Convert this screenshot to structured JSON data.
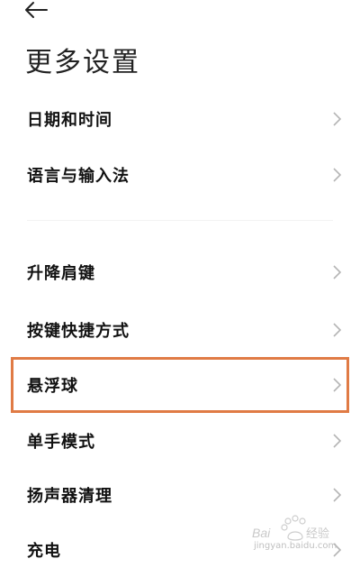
{
  "header": {
    "back_icon": "arrow-left-icon",
    "title": "更多设置"
  },
  "settings": {
    "items": [
      {
        "label": "日期和时间"
      },
      {
        "label": "语言与输入法"
      },
      {
        "label": "升降肩键"
      },
      {
        "label": "按键快捷方式"
      },
      {
        "label": "悬浮球"
      },
      {
        "label": "单手模式"
      },
      {
        "label": "扬声器清理"
      },
      {
        "label": "充电"
      }
    ],
    "highlighted_index": 4
  },
  "overlay": {
    "highlight_color": "#e07b45"
  },
  "watermark": {
    "brand": "Bai百度经验",
    "url": "jingyan.baidu.com"
  }
}
